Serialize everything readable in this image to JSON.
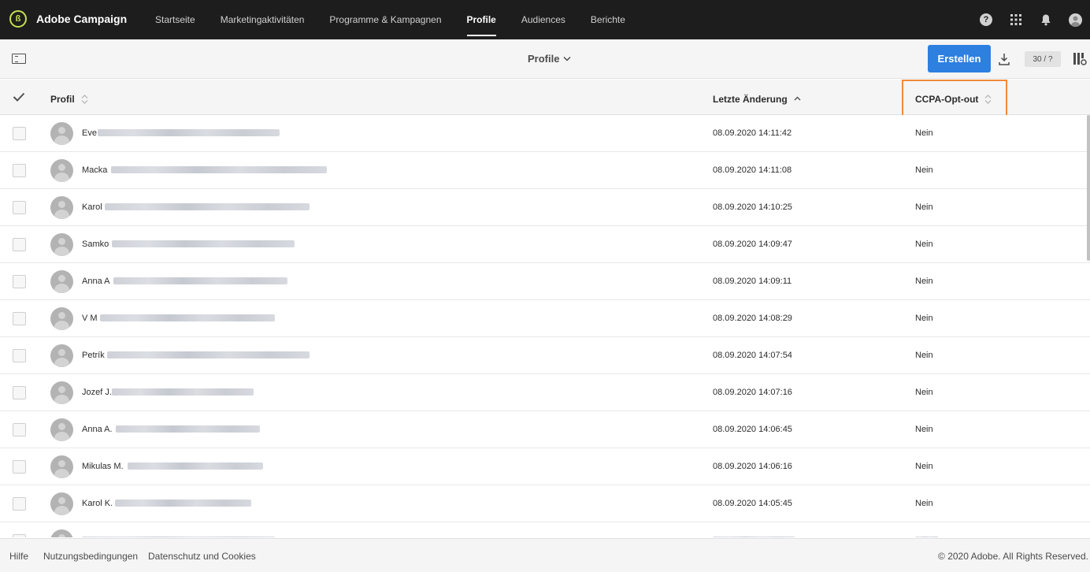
{
  "app": {
    "name": "Adobe Campaign"
  },
  "nav": {
    "items": [
      {
        "label": "Startseite"
      },
      {
        "label": "Marketingaktivitäten"
      },
      {
        "label": "Programme & Kampagnen"
      },
      {
        "label": "Profile"
      },
      {
        "label": "Audiences"
      },
      {
        "label": "Berichte"
      }
    ],
    "active": "Profile"
  },
  "toolbar": {
    "view_title": "Profile",
    "create_label": "Erstellen",
    "count": "30 / ?"
  },
  "table": {
    "columns": [
      {
        "label": "Profil"
      },
      {
        "label": "Letzte Änderung"
      },
      {
        "label": "CCPA-Opt-out"
      }
    ],
    "rows": [
      {
        "name": "Eve",
        "date": "08.09.2020 14:11:42",
        "ccpa": "Nein"
      },
      {
        "name": "Macka",
        "date": "08.09.2020 14:11:08",
        "ccpa": "Nein"
      },
      {
        "name": "Karol",
        "date": "08.09.2020 14:10:25",
        "ccpa": "Nein"
      },
      {
        "name": "Samko",
        "date": "08.09.2020 14:09:47",
        "ccpa": "Nein"
      },
      {
        "name": "Anna A",
        "date": "08.09.2020 14:09:11",
        "ccpa": "Nein"
      },
      {
        "name": "V M",
        "date": "08.09.2020 14:08:29",
        "ccpa": "Nein"
      },
      {
        "name": "Petrík",
        "date": "08.09.2020 14:07:54",
        "ccpa": "Nein"
      },
      {
        "name": "Jozef J.",
        "date": "08.09.2020 14:07:16",
        "ccpa": "Nein"
      },
      {
        "name": "Anna A.",
        "date": "08.09.2020 14:06:45",
        "ccpa": "Nein"
      },
      {
        "name": "Mikulas M.",
        "date": "08.09.2020 14:06:16",
        "ccpa": "Nein"
      },
      {
        "name": "Karol K.",
        "date": "08.09.2020 14:05:45",
        "ccpa": "Nein"
      }
    ]
  },
  "footer": {
    "links": [
      {
        "label": "Hilfe"
      },
      {
        "label": "Nutzungsbedingungen"
      },
      {
        "label": "Datenschutz und Cookies"
      }
    ],
    "copyright": "© 2020 Adobe. All Rights Reserved."
  },
  "colors": {
    "topbar_bg": "#1d1d1d",
    "primary_button": "#2d7fe0",
    "highlight_border": "#f08a3b",
    "logo_accent": "#c4e04f"
  },
  "icons": [
    "adobe-campaign-logo-icon",
    "help-icon",
    "apps-grid-icon",
    "bell-icon",
    "user-avatar-icon",
    "panel-toggle-icon",
    "chevron-down-icon",
    "download-icon",
    "column-settings-icon",
    "checkmark-icon",
    "sort-icon"
  ]
}
